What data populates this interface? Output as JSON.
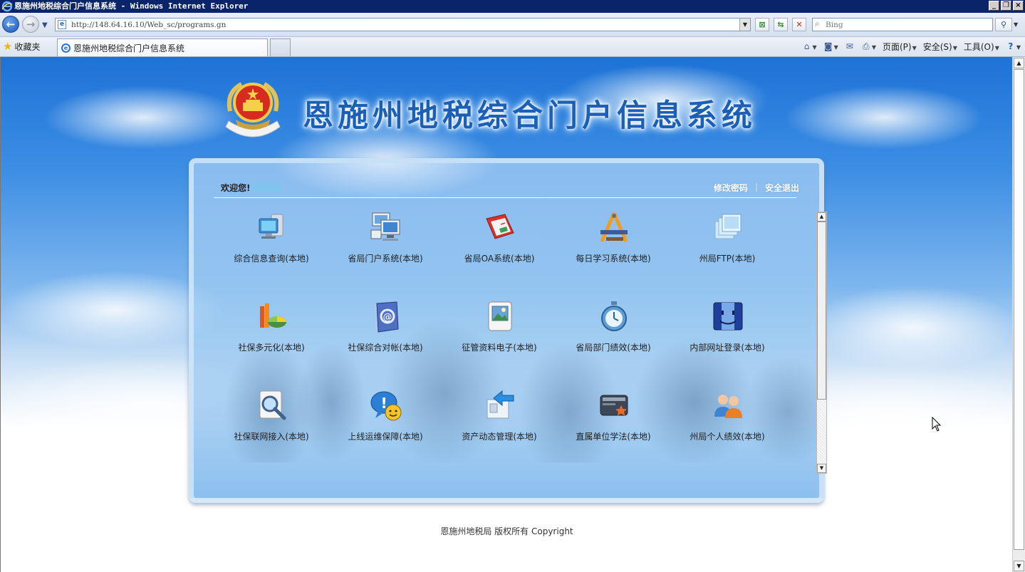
{
  "window": {
    "title": "恩施州地税综合门户信息系统 - Windows Internet Explorer"
  },
  "navbar": {
    "url": "http://148.64.16.10/Web_sc/programs.gn",
    "search_placeholder": "Bing"
  },
  "favorites_label": "收藏夹",
  "tab": {
    "title": "恩施州地税综合门户信息系统"
  },
  "command_bar": {
    "page_label": "页面(P)",
    "safety_label": "安全(S)",
    "tools_label": "工具(O)"
  },
  "page": {
    "site_title": "恩施州地税综合门户信息系统",
    "welcome_label": "欢迎您!",
    "change_password": "修改密码",
    "separator": "|",
    "logout": "安全退出",
    "apps": [
      {
        "label": "综合信息查询(本地)",
        "icon": "computer-network-icon"
      },
      {
        "label": "省局门户系统(本地)",
        "icon": "multiple-monitors-icon"
      },
      {
        "label": "省局OA系统(本地)",
        "icon": "red-book-icon"
      },
      {
        "label": "每日学习系统(本地)",
        "icon": "drafting-tools-icon"
      },
      {
        "label": "州局FTP(本地)",
        "icon": "stacked-windows-icon"
      },
      {
        "label": "社保多元化(本地)",
        "icon": "pie-chart-icon"
      },
      {
        "label": "社保综合对帐(本地)",
        "icon": "address-book-icon"
      },
      {
        "label": "征管资料电子(本地)",
        "icon": "picture-document-icon"
      },
      {
        "label": "省局部门绩效(本地)",
        "icon": "stopwatch-icon"
      },
      {
        "label": "内部网址登录(本地)",
        "icon": "finder-face-icon"
      },
      {
        "label": "社保联网接入(本地)",
        "icon": "magnifier-document-icon"
      },
      {
        "label": "上线运维保障(本地)",
        "icon": "help-smiley-icon"
      },
      {
        "label": "资产动态管理(本地)",
        "icon": "arrow-document-icon"
      },
      {
        "label": "直属单位学法(本地)",
        "icon": "star-card-icon"
      },
      {
        "label": "州局个人绩效(本地)",
        "icon": "users-icon"
      }
    ],
    "footer": "恩施州地税局 版权所有 Copyright"
  }
}
